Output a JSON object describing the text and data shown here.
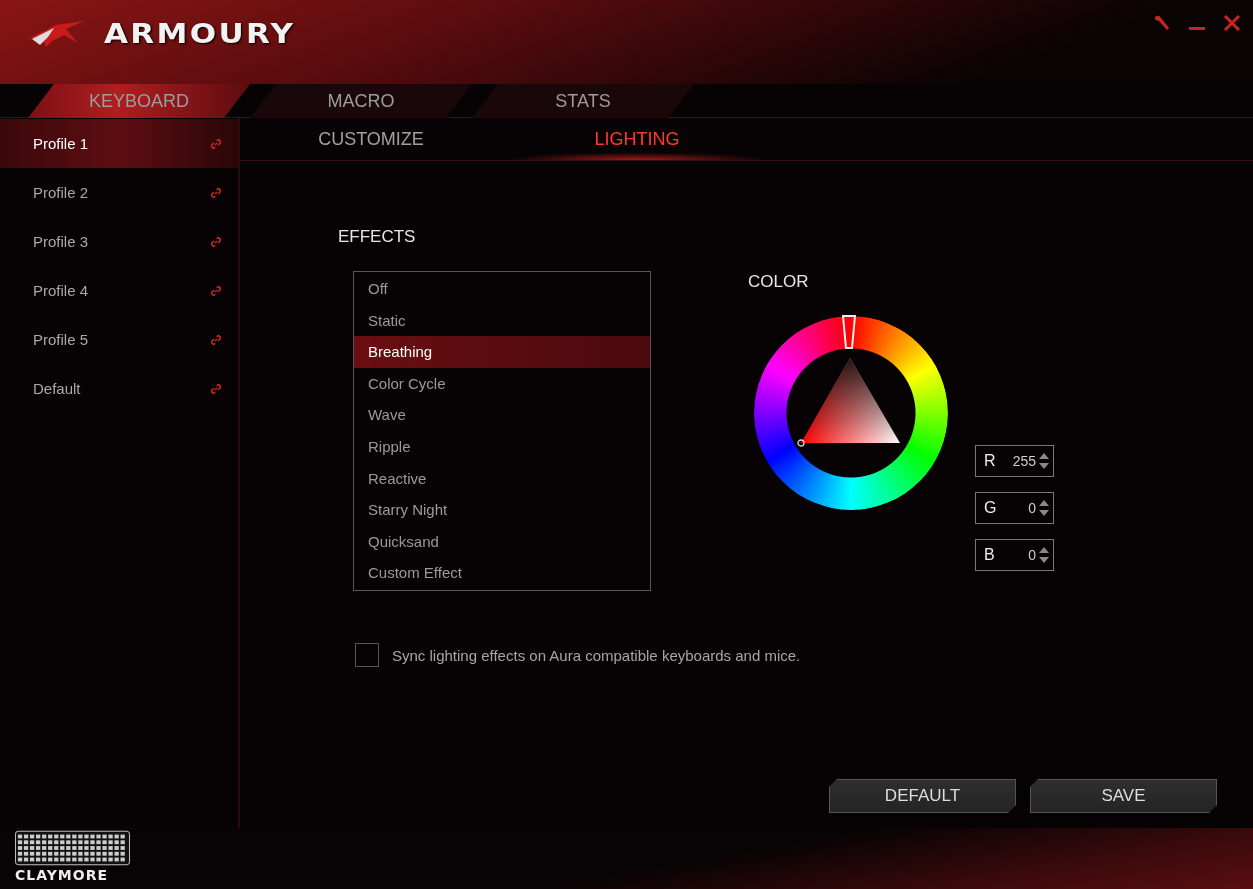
{
  "window": {
    "title": "ARMOURY"
  },
  "tabs": [
    {
      "label": "KEYBOARD",
      "selected": true
    },
    {
      "label": "MACRO",
      "selected": false
    },
    {
      "label": "STATS",
      "selected": false
    }
  ],
  "profiles": [
    {
      "label": "Profile 1",
      "selected": true
    },
    {
      "label": "Profile 2",
      "selected": false
    },
    {
      "label": "Profile 3",
      "selected": false
    },
    {
      "label": "Profile 4",
      "selected": false
    },
    {
      "label": "Profile 5",
      "selected": false
    },
    {
      "label": "Default",
      "selected": false
    }
  ],
  "subtabs": [
    {
      "label": "CUSTOMIZE",
      "selected": false
    },
    {
      "label": "LIGHTING",
      "selected": true
    }
  ],
  "effects": {
    "title": "EFFECTS",
    "items": [
      {
        "label": "Off",
        "selected": false
      },
      {
        "label": "Static",
        "selected": false
      },
      {
        "label": "Breathing",
        "selected": true
      },
      {
        "label": "Color Cycle",
        "selected": false
      },
      {
        "label": "Wave",
        "selected": false
      },
      {
        "label": "Ripple",
        "selected": false
      },
      {
        "label": "Reactive",
        "selected": false
      },
      {
        "label": "Starry Night",
        "selected": false
      },
      {
        "label": "Quicksand",
        "selected": false
      },
      {
        "label": "Custom Effect",
        "selected": false
      }
    ]
  },
  "color": {
    "title": "COLOR",
    "channels": [
      {
        "label": "R",
        "value": "255"
      },
      {
        "label": "G",
        "value": "0"
      },
      {
        "label": "B",
        "value": "0"
      }
    ]
  },
  "sync": {
    "label": "Sync lighting effects on Aura compatible keyboards and mice.",
    "checked": false
  },
  "buttons": [
    {
      "label": "DEFAULT"
    },
    {
      "label": "SAVE"
    }
  ],
  "device": {
    "name": "CLAYMORE"
  }
}
